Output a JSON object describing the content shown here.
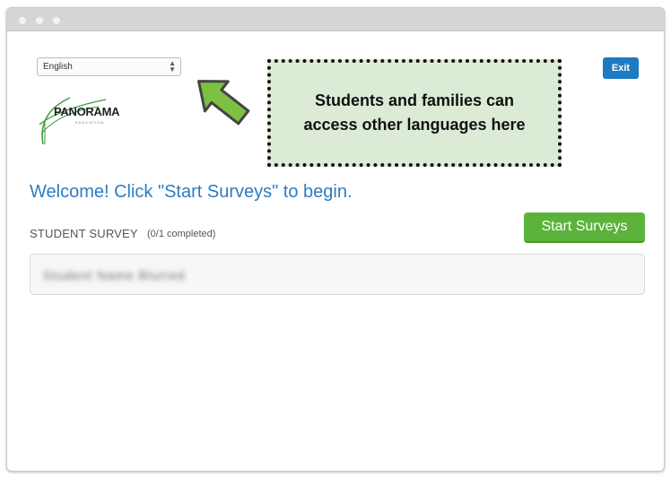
{
  "language_select": {
    "value": "English"
  },
  "logo": {
    "name": "PANORAMA",
    "sub": "EDUCATION"
  },
  "callout": {
    "text": "Students and families can access other languages here"
  },
  "header": {
    "exit_label": "Exit"
  },
  "welcome": {
    "text": "Welcome! Click \"Start Surveys\" to begin."
  },
  "survey": {
    "label": "STUDENT SURVEY",
    "count": "(0/1 completed)",
    "start_label": "Start Surveys",
    "student_name": "Student Name Blurred"
  },
  "colors": {
    "accent": "#1f7bc1",
    "start": "#5cb33c",
    "callout_bg": "#dcebd6",
    "arrow": "#7cc142"
  }
}
